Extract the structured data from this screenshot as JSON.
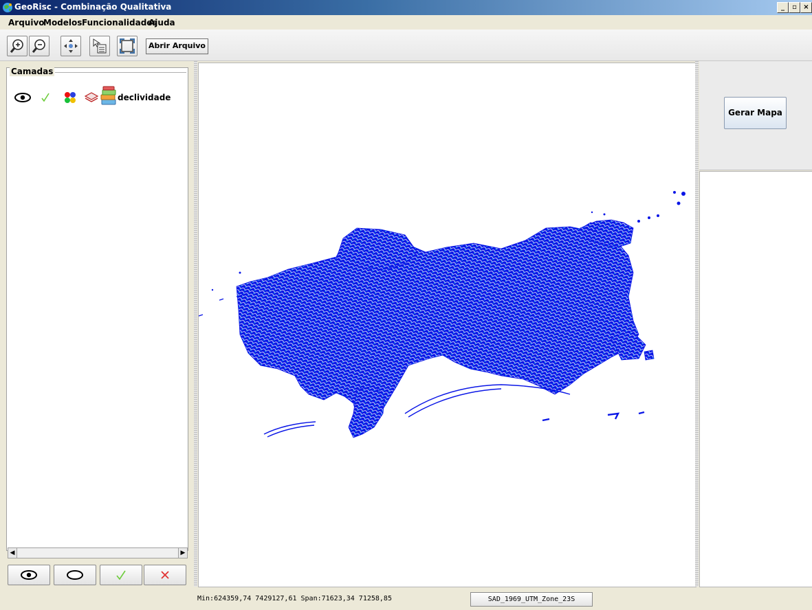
{
  "window": {
    "title": "GeoRisc - Combinação Qualitativa",
    "controls": {
      "minimize": "_",
      "maximize": "▫",
      "close": "×"
    }
  },
  "menubar": {
    "items": [
      "Arquivo",
      "Modelos",
      "Funcionalidades",
      "Ajuda"
    ]
  },
  "toolbar": {
    "tools": [
      "zoom-in-icon",
      "zoom-out-icon",
      "pan-icon",
      "info-icon",
      "full-extent-icon"
    ],
    "open_file_label": "Abrir Arquivo"
  },
  "layers_panel": {
    "title": "Camadas",
    "layers": [
      {
        "name": "declividade",
        "visible": true,
        "active": true
      }
    ],
    "bottom_buttons": [
      "show-all-icon",
      "hide-all-icon",
      "check-icon",
      "remove-icon"
    ]
  },
  "map": {
    "colors": {
      "primary": "#0a16e6",
      "highlight": "#18b0f0"
    }
  },
  "right_panel": {
    "generate_button": "Gerar Mapa"
  },
  "status": {
    "extent_text": "Min:624359,74 7429127,61 Span:71623,34 71258,85",
    "projection": "SAD_1969_UTM_Zone_23S"
  }
}
